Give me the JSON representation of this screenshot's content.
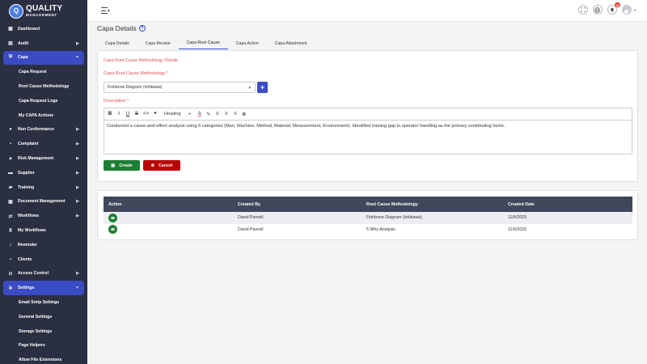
{
  "brand": {
    "logo_letter": "Q",
    "name": "QUALITY",
    "sub": "MANAGEMENT"
  },
  "sidebar": {
    "items": [
      {
        "label": "Dashboard",
        "icon": "dashboard-icon",
        "arrow": false
      },
      {
        "label": "Audit",
        "icon": "clipboard-icon",
        "arrow": true
      },
      {
        "label": "Capa",
        "icon": "shield-icon",
        "arrow": true,
        "active": true
      },
      {
        "label": "Capa Request",
        "sub": true
      },
      {
        "label": "Root Cause Methodology",
        "sub": true
      },
      {
        "label": "Capa Request Logs",
        "sub": true
      },
      {
        "label": "My CAPA Actions",
        "sub": true
      },
      {
        "label": "Non Conformance",
        "icon": "alert-circle-icon",
        "arrow": true
      },
      {
        "label": "Complaint",
        "icon": "comment-icon",
        "arrow": true
      },
      {
        "label": "Risk Management",
        "icon": "warning-icon",
        "arrow": true
      },
      {
        "label": "Supplier",
        "icon": "truck-icon",
        "arrow": true
      },
      {
        "label": "Training",
        "icon": "graduation-icon",
        "arrow": true
      },
      {
        "label": "Document Management",
        "icon": "folder-icon",
        "arrow": true
      },
      {
        "label": "Workflows",
        "icon": "workflow-icon",
        "arrow": true
      },
      {
        "label": "My Workflows",
        "icon": "hourglass-icon",
        "arrow": false
      },
      {
        "label": "Reminder",
        "icon": "bell-icon",
        "arrow": false
      },
      {
        "label": "Clients",
        "icon": "users-icon",
        "arrow": false
      },
      {
        "label": "Access Control",
        "icon": "lock-icon",
        "arrow": true
      },
      {
        "label": "Settings",
        "icon": "gear-icon",
        "arrow": true,
        "active": true
      },
      {
        "label": "Email Smtp Settings",
        "sub": true
      },
      {
        "label": "General Settings",
        "sub": true
      },
      {
        "label": "Storage Settings",
        "sub": true
      },
      {
        "label": "Page Helpers",
        "sub": true
      },
      {
        "label": "Allow File Extensions",
        "sub": true
      }
    ]
  },
  "topbar": {
    "notification_count": "10"
  },
  "page": {
    "title": "Capa Details",
    "help_glyph": "?",
    "tabs": [
      "Capa Details",
      "Capa Review",
      "Capa Root Cause",
      "Capa Action",
      "Capa Attachment"
    ]
  },
  "form": {
    "section_title": "Capa Root Cause Methodology Details",
    "methodology_label": "Capa Root Cause Methodology *",
    "methodology_value": "Fishbone Diagram (Ishikawa)",
    "add_glyph": "+",
    "description_label": "Description *",
    "heading_select": "Heading",
    "description_text": "Conducted a cause-and-effect analysis using 6 categories (Man, Machine, Method, Material, Measurement, Environment). Identified training gap in operator handling as the primary contributing factor.",
    "create_label": "Create",
    "cancel_label": "Cancel"
  },
  "table": {
    "headers": [
      "Action",
      "Created By",
      "Root Cause Methodology",
      "Created Date"
    ],
    "rows": [
      {
        "created_by": "David Parnell",
        "methodology": "Fishbone Diagram (Ishikawa)",
        "date": "11/6/2025"
      },
      {
        "created_by": "David Parnell",
        "methodology": "5 Why Analysis",
        "date": "11/6/2025"
      }
    ]
  },
  "colors": {
    "accent": "#3a4bc4",
    "sidebar_bg": "#2a3042",
    "create": "#1e7e34",
    "cancel": "#bb0000",
    "required": "#e15050"
  }
}
